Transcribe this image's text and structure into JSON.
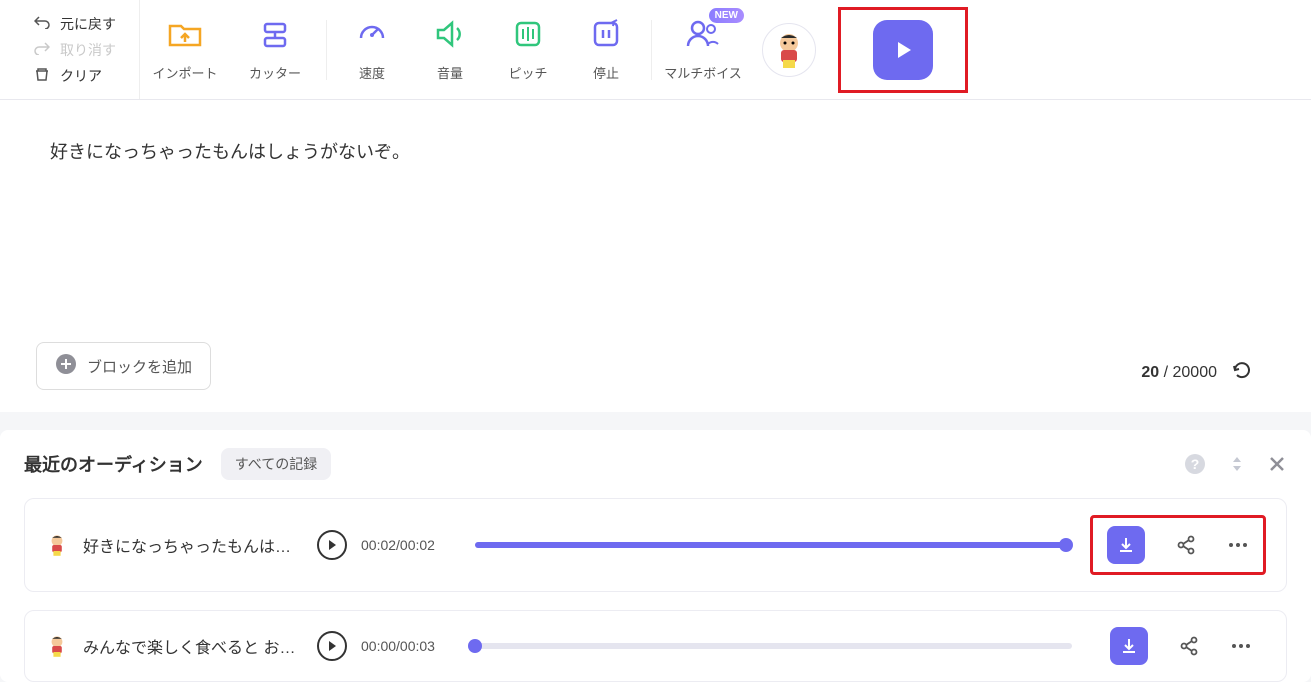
{
  "left_actions": {
    "undo": "元に戻す",
    "redo": "取り消す",
    "clear": "クリア"
  },
  "toolbar": {
    "import": "インポート",
    "cutter": "カッター",
    "speed": "速度",
    "volume": "音量",
    "pitch": "ピッチ",
    "pause": "停止",
    "multivoice": "マルチボイス",
    "new_badge": "NEW"
  },
  "editor": {
    "text": "好きになっちゃったもんはしょうがないぞ。",
    "add_block": "ブロックを追加",
    "chars_current": "20",
    "chars_sep": " / ",
    "chars_max": "20000"
  },
  "audition": {
    "title": "最近のオーディション",
    "filter": "すべての記録",
    "tracks": [
      {
        "title": "好きになっちゃったもんはし...",
        "time": "00:02/00:02",
        "progress": 100
      },
      {
        "title": "みんなで楽しく食べると おい...",
        "time": "00:00/00:03",
        "progress": 0
      }
    ]
  }
}
